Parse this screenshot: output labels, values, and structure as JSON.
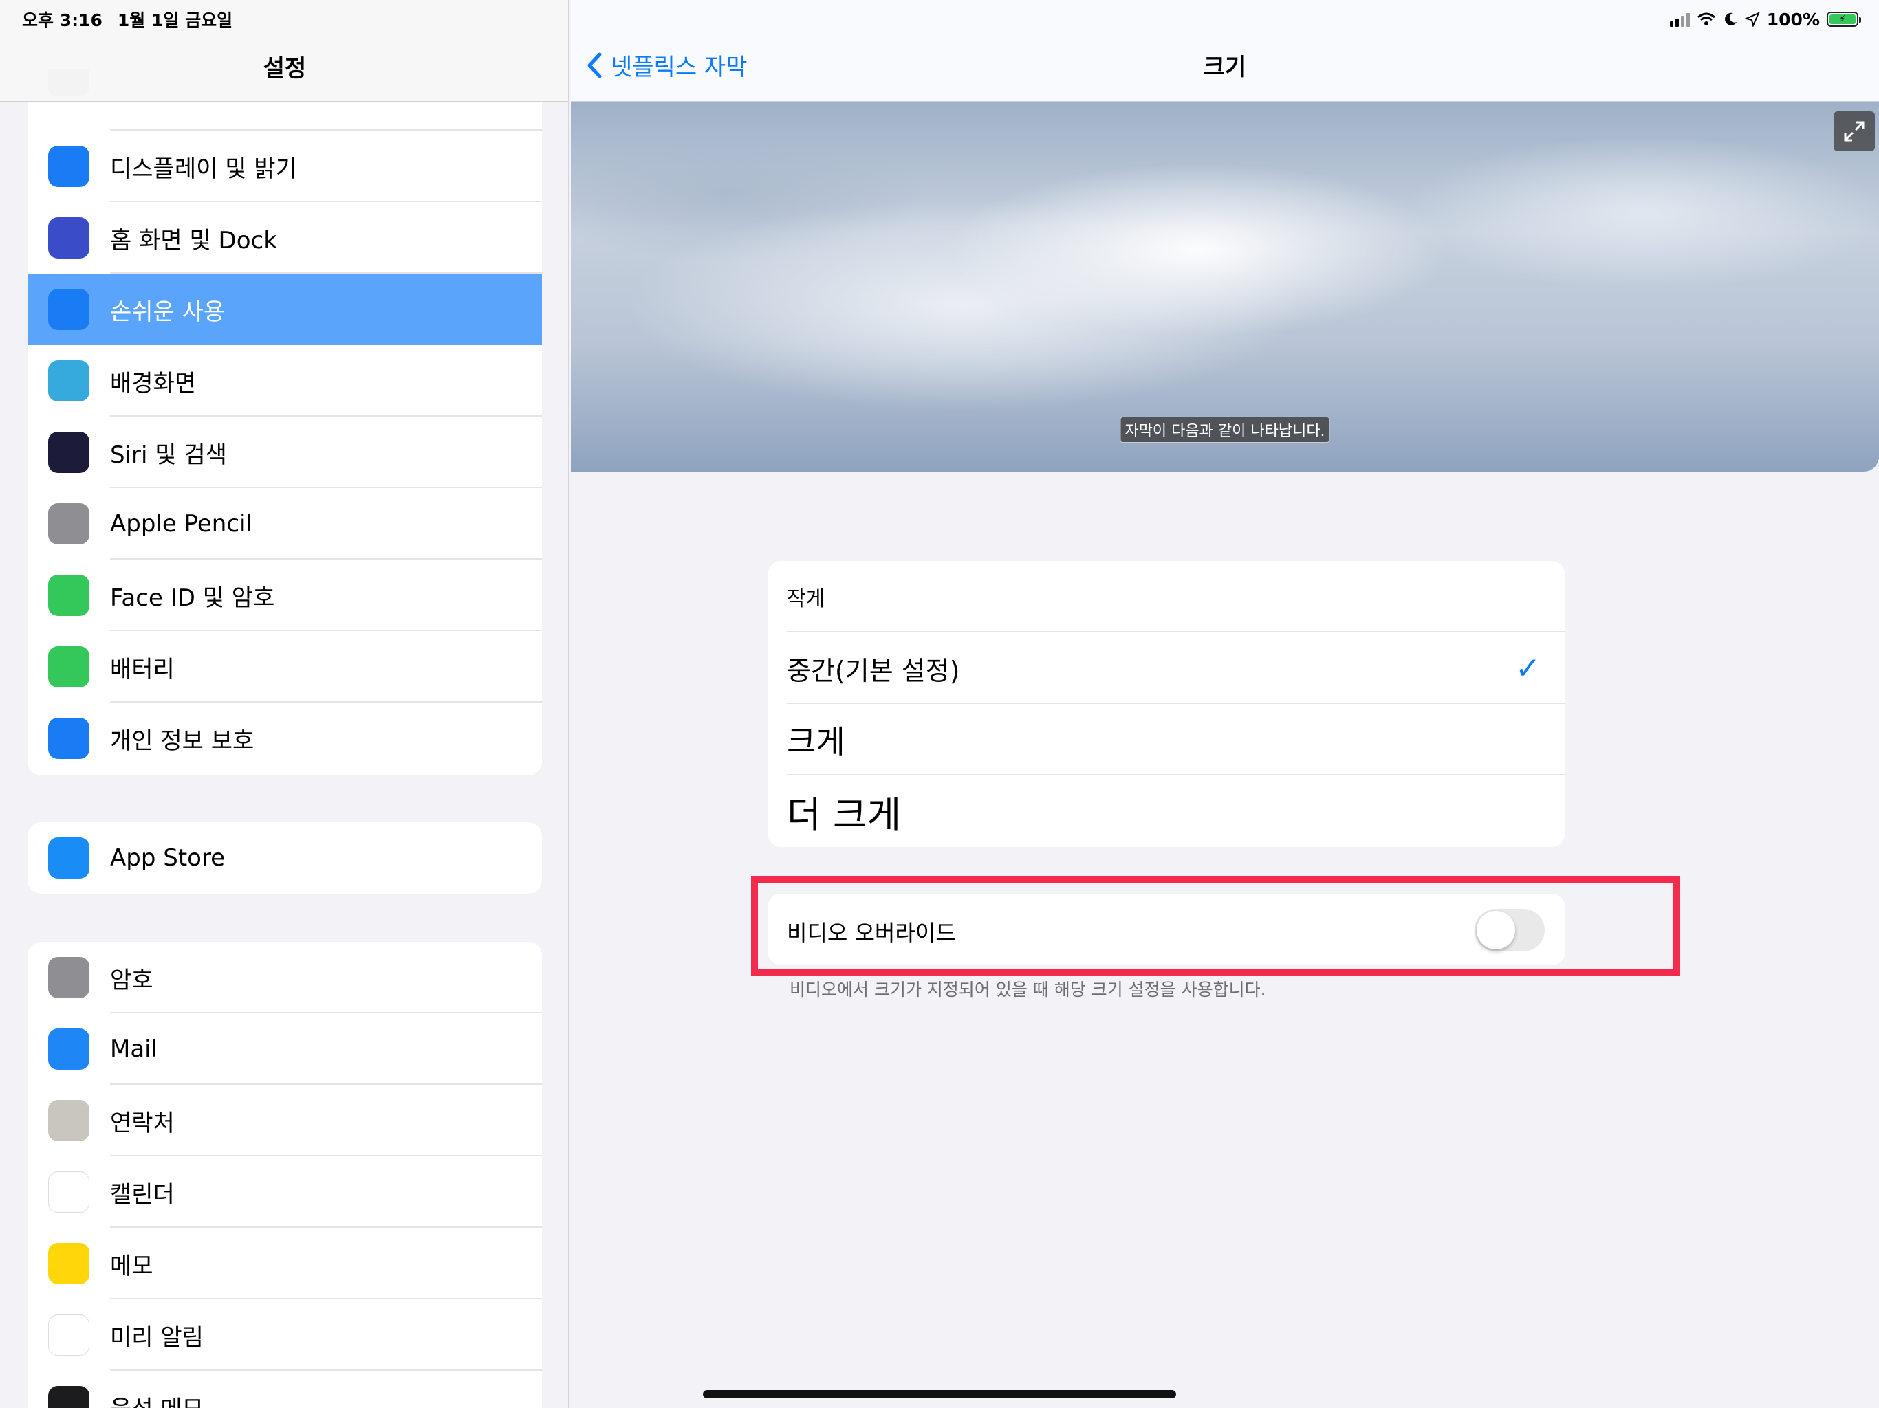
{
  "status_bar": {
    "time": "오후 3:16",
    "date": "1월 1일 금요일",
    "battery_pct": "100%"
  },
  "sidebar": {
    "title": "설정",
    "group1": [
      {
        "label": "디스플레이 및 밝기",
        "icon": "display-brightness-icon",
        "color": "#1a7cf5"
      },
      {
        "label": "홈 화면 및 Dock",
        "icon": "home-screen-icon",
        "color": "#3b4cc9"
      },
      {
        "label": "손쉬운 사용",
        "icon": "accessibility-icon",
        "color": "#1a7cf5",
        "selected": true
      },
      {
        "label": "배경화면",
        "icon": "wallpaper-icon",
        "color": "#36aadc"
      },
      {
        "label": "Siri 및 검색",
        "icon": "siri-icon",
        "color": "#1c1c3a"
      },
      {
        "label": "Apple Pencil",
        "icon": "pencil-icon",
        "color": "#8e8e93"
      },
      {
        "label": "Face ID 및 암호",
        "icon": "face-id-icon",
        "color": "#34c759"
      },
      {
        "label": "배터리",
        "icon": "battery-icon",
        "color": "#34c759"
      },
      {
        "label": "개인 정보 보호",
        "icon": "privacy-hand-icon",
        "color": "#1a7cf5"
      }
    ],
    "group2": [
      {
        "label": "App Store",
        "icon": "app-store-icon",
        "color": "#1a8cf5"
      }
    ],
    "group3": [
      {
        "label": "암호",
        "icon": "key-icon",
        "color": "#8e8e93"
      },
      {
        "label": "Mail",
        "icon": "mail-icon",
        "color": "#1e86f5"
      },
      {
        "label": "연락처",
        "icon": "contacts-icon",
        "color": "#c9c6c0"
      },
      {
        "label": "캘린더",
        "icon": "calendar-icon",
        "color": "#ffffff"
      },
      {
        "label": "메모",
        "icon": "notes-icon",
        "color": "#ffd60a"
      },
      {
        "label": "미리 알림",
        "icon": "reminders-icon",
        "color": "#ffffff"
      },
      {
        "label": "음성 메모",
        "icon": "voice-memo-icon",
        "color": "#1c1c1e"
      }
    ]
  },
  "detail": {
    "back_label": "넷플릭스 자막",
    "title": "크기",
    "caption_preview": "자막이 다음과 같이 나타납니다.",
    "sizes": [
      {
        "label": "작게",
        "font_px": 30,
        "checked": false
      },
      {
        "label": "중간(기본 설정)",
        "font_px": 38,
        "checked": true
      },
      {
        "label": "크게",
        "font_px": 46,
        "checked": false
      },
      {
        "label": "더 크게",
        "font_px": 54,
        "checked": false
      }
    ],
    "override_label": "비디오 오버라이드",
    "override_on": false,
    "footnote": "비디오에서 크기가 지정되어 있을 때 해당 크기 설정을 사용합니다."
  }
}
